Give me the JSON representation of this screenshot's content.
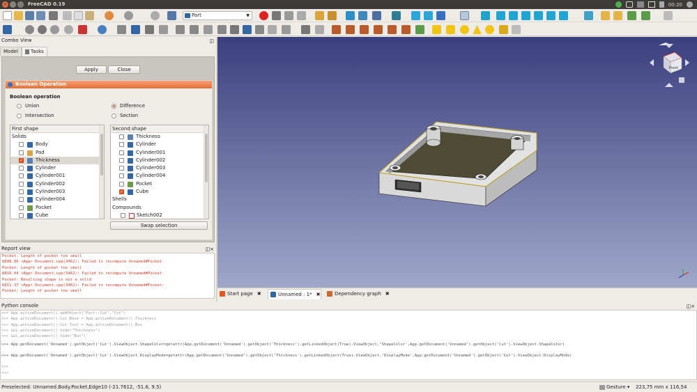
{
  "window": {
    "title": "FreeCAD 0.19"
  },
  "tray": {
    "time": "00:20"
  },
  "workbench": {
    "selected": "Part"
  },
  "combo_view": {
    "title": "Combo View",
    "tabs": [
      {
        "label": "Model"
      },
      {
        "label": "Tasks"
      }
    ],
    "apply_label": "Apply",
    "close_label": "Close",
    "boolean": {
      "header": "Boolean Operation",
      "op_label": "Boolean operation",
      "options": [
        {
          "label": "Union",
          "checked": false
        },
        {
          "label": "Difference",
          "checked": true
        },
        {
          "label": "Intersection",
          "checked": false
        },
        {
          "label": "Section",
          "checked": false
        }
      ],
      "first_header": "First shape",
      "first_group": "Solids",
      "first_items": [
        {
          "label": "Body",
          "checked": false,
          "selected": false,
          "icon": "body-icon",
          "color": "#3465a4"
        },
        {
          "label": "Pad",
          "checked": false,
          "selected": false,
          "icon": "pad-icon",
          "color": "#d7a54a"
        },
        {
          "label": "Thickness",
          "checked": true,
          "selected": true,
          "icon": "thickness-icon",
          "color": "#5d7fae"
        },
        {
          "label": "Cylinder",
          "checked": false,
          "selected": false,
          "icon": "cylinder-icon",
          "color": "#3465a4"
        },
        {
          "label": "Cylinder001",
          "checked": false,
          "selected": false,
          "icon": "cylinder-icon",
          "color": "#3465a4"
        },
        {
          "label": "Cylinder002",
          "checked": false,
          "selected": false,
          "icon": "cylinder-icon",
          "color": "#3465a4"
        },
        {
          "label": "Cylinder003",
          "checked": false,
          "selected": false,
          "icon": "cylinder-icon",
          "color": "#3465a4"
        },
        {
          "label": "Cylinder004",
          "checked": false,
          "selected": false,
          "icon": "cylinder-icon",
          "color": "#3465a4"
        },
        {
          "label": "Pocket",
          "checked": false,
          "selected": false,
          "icon": "pocket-icon",
          "color": "#6a9a4a"
        },
        {
          "label": "Cube",
          "checked": false,
          "selected": false,
          "icon": "cube-icon",
          "color": "#3465a4"
        }
      ],
      "second_header": "Second shape",
      "second_items": [
        {
          "label": "Thickness",
          "checked": false,
          "icon": "thickness-icon",
          "color": "#5d7fae"
        },
        {
          "label": "Cylinder",
          "checked": false,
          "icon": "cylinder-icon",
          "color": "#3465a4"
        },
        {
          "label": "Cylinder001",
          "checked": false,
          "icon": "cylinder-icon",
          "color": "#3465a4"
        },
        {
          "label": "Cylinder002",
          "checked": false,
          "icon": "cylinder-icon",
          "color": "#3465a4"
        },
        {
          "label": "Cylinder003",
          "checked": false,
          "icon": "cylinder-icon",
          "color": "#3465a4"
        },
        {
          "label": "Cylinder004",
          "checked": false,
          "icon": "cylinder-icon",
          "color": "#3465a4"
        },
        {
          "label": "Pocket",
          "checked": false,
          "icon": "pocket-icon",
          "color": "#6a9a4a"
        },
        {
          "label": "Cube",
          "checked": true,
          "icon": "cube-icon",
          "color": "#3465a4"
        }
      ],
      "second_shells": "Shells",
      "second_compounds": "Compounds",
      "second_last": {
        "label": "Sketch002",
        "checked": false,
        "icon": "sketch-icon",
        "color": "#cc3333"
      },
      "swap_label": "Swap selection"
    }
  },
  "report_view": {
    "title": "Report view",
    "lines": [
      "Pocket: Length of pocket too small",
      "8808.86 <App> Document.cpp(3462): Failed to recompute Unnamed#Pocket:",
      "Pocket: Length of pocket too small",
      "8810.04 <App> Document.cpp(3462): Failed to recompute Unnamed#Pocket:",
      "Pocket: Resulting shape is not a solid",
      "8811.37 <App> Document.cpp(3462): Failed to recompute Unnamed#Pocket:",
      "Pocket: Length of pocket too small"
    ]
  },
  "nav_cube": {
    "face": "Front"
  },
  "doc_tabs": [
    {
      "label": "Start page",
      "active": false,
      "icon_color": "#e95420"
    },
    {
      "label": "Unnamed : 1*",
      "active": true,
      "icon_color": "#3465a4"
    },
    {
      "label": "Dependency graph",
      "active": false,
      "icon_color": "#cc6633"
    }
  ],
  "python_console": {
    "title": "Python console",
    "lines": [
      ">>> App.activeDocument().addObject(\"Part::Cut\",\"Cut\")",
      ">>> App.activeDocument().Cut.Base = App.activeDocument().Thickness",
      ">>> App.activeDocument().Cut.Tool = App.activeDocument().Box",
      ">>> Gui.activeDocument().hide(\"Thickness\")",
      ">>> Gui.activeDocument().hide(\"Box\")",
      ">>> App.getDocument('Unnamed').getObject('Cut').ViewObject.ShapeColor=getattr(App.getDocument('Unnamed').getObject('Thickness').getLinkedObject(True).ViewObject,'ShapeColor',App.getDocument('Unnamed').getObject('Cut').ViewObject.ShapeColor)",
      ">>> App.getDocument('Unnamed').getObject('Cut').ViewObject.DisplayMode=getattr(App.getDocument('Unnamed').getObject('Thickness').getLinkedObject(True).ViewObject,'DisplayMode',App.getDocument('Unnamed').getObject('Cut').ViewObject.DisplayMode)",
      ">>>",
      ">>>"
    ]
  },
  "status": {
    "preselected": "Preselected: Unnamed.Body.Pocket.Edge10 (-21.7612, -51.6, 9.5)",
    "nav_style": "Gesture",
    "dimensions": "223,75 mm x 116,54 mm"
  },
  "colors": {
    "accent": "#e95420",
    "viewport_top": "#3a3f7e",
    "viewport_bottom": "#9fa8c9"
  }
}
